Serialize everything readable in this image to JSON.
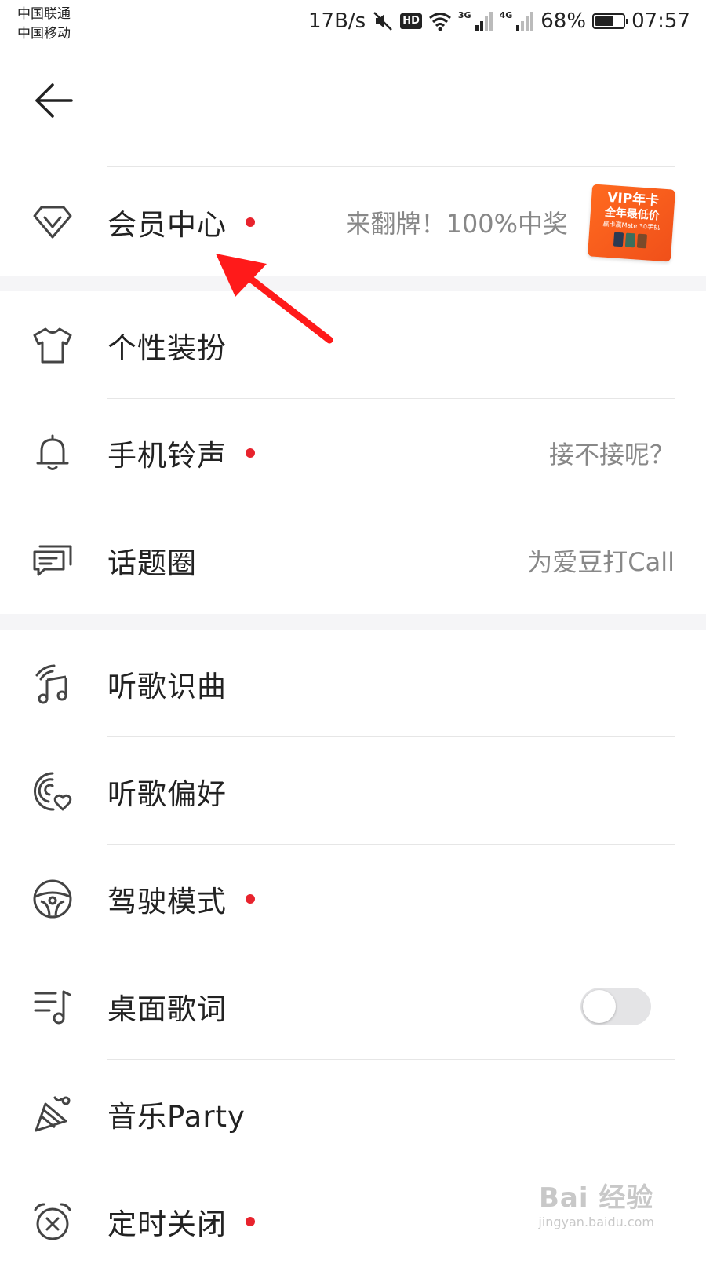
{
  "statusbar": {
    "carrier1": "中国联通",
    "carrier2": "中国移动",
    "net_speed": "17B/s",
    "hd": "HD",
    "net1": "3G",
    "net2": "4G",
    "battery": "68%",
    "battery_level": 0.68,
    "time": "07:57"
  },
  "header": {
    "back_icon": "arrow-left-icon"
  },
  "vip": {
    "label": "会员中心",
    "right_text": "来翻牌！100%中奖",
    "badge": {
      "line1": "VIP年卡",
      "line2": "全年最低价",
      "line3": "赢卡赢Mate 30手机"
    }
  },
  "items": [
    {
      "label": "个性装扮",
      "icon": "tshirt-icon",
      "right_text": ""
    },
    {
      "label": "手机铃声",
      "icon": "bell-icon",
      "right_text": "接不接呢？"
    },
    {
      "label": "话题圈",
      "icon": "chat-cards-icon",
      "right_text": "为爱豆打Call"
    },
    {
      "label": "听歌识曲",
      "icon": "music-recognition-icon",
      "right_text": ""
    },
    {
      "label": "听歌偏好",
      "icon": "music-preference-icon",
      "right_text": ""
    },
    {
      "label": "驾驶模式",
      "icon": "steering-wheel-icon",
      "right_text": ""
    },
    {
      "label": "桌面歌词",
      "icon": "lyrics-icon",
      "right_text": ""
    },
    {
      "label": "音乐Party",
      "icon": "party-hat-icon",
      "right_text": ""
    },
    {
      "label": "定时关闭",
      "icon": "alarm-clock-icon",
      "right_text": ""
    }
  ],
  "desktop_lyrics_toggle": {
    "state": "off"
  },
  "watermark": {
    "main": "Bai 经验",
    "sub": "jingyan.baidu.com"
  },
  "colors": {
    "badge_dot": "#e8232d",
    "annotation_arrow": "#ff1a1a",
    "toggle_off": "#e4e4e6"
  }
}
